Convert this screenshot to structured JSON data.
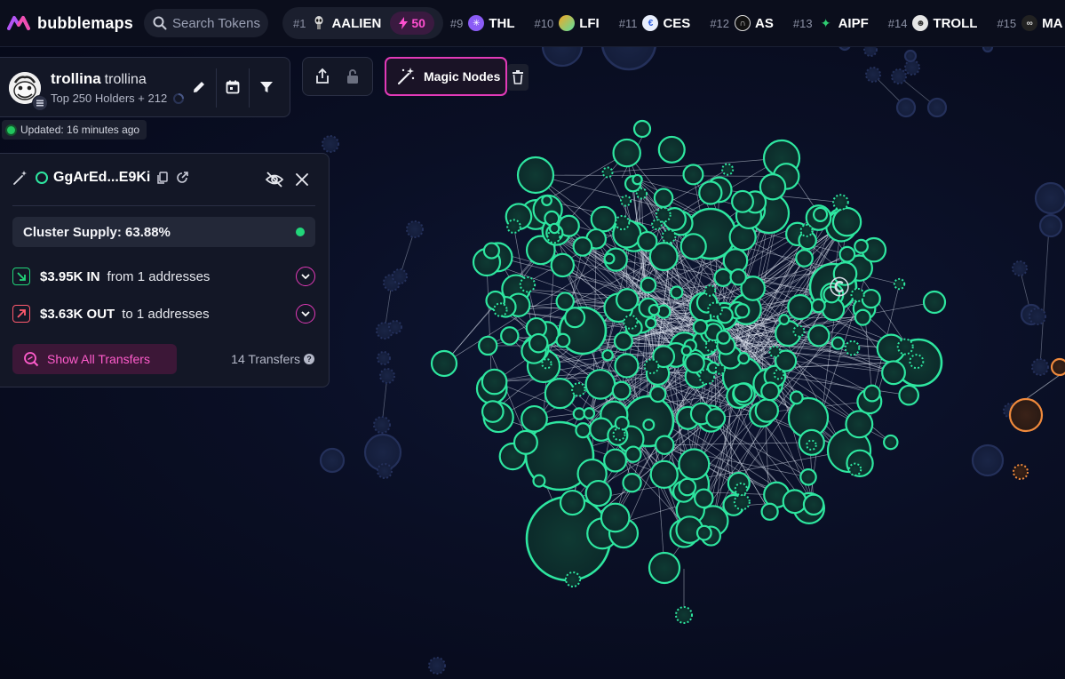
{
  "app": {
    "brand": "bubblemaps",
    "search_placeholder": "Search Tokens"
  },
  "ticker": [
    {
      "rank": "#1",
      "symbol": "AALIEN",
      "icon": "alien-token-icon",
      "boost": "50"
    },
    {
      "rank": "#9",
      "symbol": "THL",
      "icon": "thl-token-icon"
    },
    {
      "rank": "#10",
      "symbol": "LFI",
      "icon": "lfi-token-icon"
    },
    {
      "rank": "#11",
      "symbol": "CES",
      "icon": "ces-token-icon"
    },
    {
      "rank": "#12",
      "symbol": "AS",
      "icon": "as-token-icon"
    },
    {
      "rank": "#13",
      "symbol": "AIPF",
      "icon": "aipf-token-icon"
    },
    {
      "rank": "#14",
      "symbol": "TROLL",
      "icon": "troll-token-icon"
    },
    {
      "rank": "#15",
      "symbol": "MA",
      "icon": "ma-token-icon"
    }
  ],
  "token": {
    "name": "trollina",
    "symbol": "trollina",
    "holders_text": "Top 250 Holders + 212",
    "updated_text": "Updated: 16 minutes ago"
  },
  "toolbar": {
    "magic_nodes_label": "Magic Nodes"
  },
  "cluster": {
    "address": "GgArEd...E9Ki",
    "supply_text": "Cluster Supply: 63.88%",
    "inflow": {
      "amount": "$3.95K IN",
      "detail": "from 1 addresses"
    },
    "outflow": {
      "amount": "$3.63K OUT",
      "detail": "to 1 addresses"
    },
    "show_all_label": "Show All Transfers",
    "transfers_count": "14 Transfers"
  },
  "colors": {
    "cluster_node": "#2ee6a0",
    "other_node": "#1c2748",
    "highlight_node": "#f08a3c",
    "accent": "#e23ab8"
  }
}
